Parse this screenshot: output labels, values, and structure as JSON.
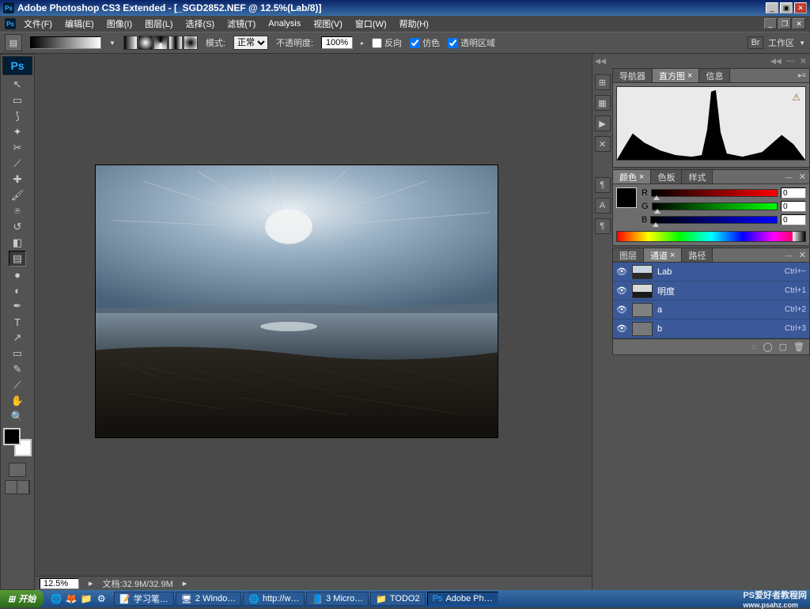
{
  "title": "Adobe Photoshop CS3 Extended - [_SGD2852.NEF @ 12.5%(Lab/8)]",
  "menus": [
    "文件(F)",
    "编辑(E)",
    "图像(I)",
    "图层(L)",
    "选择(S)",
    "滤镜(T)",
    "Analysis",
    "视图(V)",
    "窗口(W)",
    "帮助(H)"
  ],
  "opt": {
    "mode_label": "模式:",
    "mode_val": "正常",
    "opacity_label": "不透明度:",
    "opacity_val": "100%",
    "reverse": "反向",
    "dither": "仿色",
    "transparency": "透明区域",
    "workspace": "工作区"
  },
  "icons": {
    "move": "↖",
    "marquee": "▭",
    "lasso": "⟆",
    "wand": "✦",
    "crop": "✂",
    "slice": "⟋",
    "heal": "✚",
    "brush": "🖌",
    "stamp": "⍟",
    "history": "↺",
    "eraser": "◧",
    "gradient": "▤",
    "blur": "●",
    "dodge": "◐",
    "pen": "✒",
    "type": "T",
    "path": "↗",
    "shape": "▭",
    "notes": "✎",
    "eyedrop": "⟋",
    "hand": "✋",
    "zoom": "🔍"
  },
  "strip": [
    "⊞",
    "▦",
    "▶",
    "✕",
    "¶",
    "A",
    "¶"
  ],
  "nav": {
    "t1": "导航器",
    "t2": "直方图",
    "t3": "信息"
  },
  "color": {
    "t1": "颜色",
    "t2": "色板",
    "t3": "样式",
    "r_label": "R",
    "g_label": "G",
    "b_label": "B",
    "r": "0",
    "g": "0",
    "b": "0"
  },
  "chn": {
    "t1": "图层",
    "t2": "通道",
    "t3": "路径",
    "rows": [
      {
        "name": "Lab",
        "sc": "Ctrl+~",
        "cls": "lab"
      },
      {
        "name": "明度",
        "sc": "Ctrl+1",
        "cls": "lum"
      },
      {
        "name": "a",
        "sc": "Ctrl+2",
        "cls": "a"
      },
      {
        "name": "b",
        "sc": "Ctrl+3",
        "cls": "b"
      }
    ]
  },
  "status": {
    "zoom": "12.5%",
    "doc": "文档:32.9M/32.9M"
  },
  "taskbar": {
    "start": "开始",
    "tasks": [
      "学习笔…",
      "2 Windo…",
      "http://w…",
      "3 Micro…",
      "TODO2",
      "Adobe Ph…"
    ]
  },
  "watermark1": "PS爱好者教程网",
  "watermark2": "www.psahz.com"
}
